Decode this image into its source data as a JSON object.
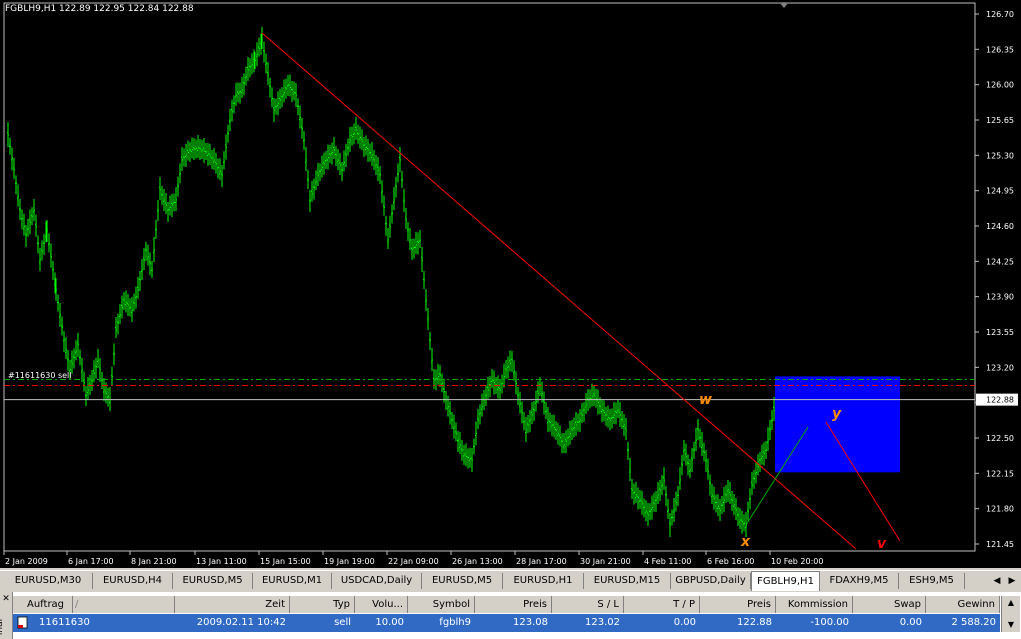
{
  "chart": {
    "symbol_header": "FGBLH9,H1  122.89 122.95 122.84 122.88",
    "current_price": "122.88",
    "order_label": "#11611630 sell",
    "wave_labels": [
      "w",
      "x",
      "y",
      "v"
    ],
    "price_ticks": [
      "126.70",
      "126.35",
      "126.00",
      "125.65",
      "125.30",
      "124.95",
      "124.60",
      "124.25",
      "123.90",
      "123.55",
      "123.20",
      "122.85",
      "122.50",
      "122.15",
      "121.80",
      "121.45"
    ],
    "time_ticks": [
      "2 Jan 2009",
      "6 Jan 17:00",
      "8 Jan 21:00",
      "13 Jan 11:00",
      "15 Jan 15:00",
      "19 Jan 19:00",
      "22 Jan 09:00",
      "26 Jan 13:00",
      "28 Jan 17:00",
      "30 Jan 21:00",
      "4 Feb 11:00",
      "6 Feb 16:00",
      "10 Feb 20:00"
    ],
    "colors": {
      "bars": "#00ff00",
      "trendline": "#ff0000",
      "zone": "#0000ff",
      "wave_orange": "#ff8c00",
      "wave_red": "#ff0000",
      "bid_line": "#c0c0c0"
    }
  },
  "tabs": [
    "EURUSD,M30",
    "EURUSD,H4",
    "EURUSD,M5",
    "EURUSD,M1",
    "USDCAD,Daily",
    "EURUSD,M5",
    "EURUSD,H1",
    "EURUSD,M15",
    "GBPUSD,Daily",
    "FGBLH9,H1",
    "FDAXH9,M5",
    "ESH9,M5"
  ],
  "active_tab": "FGBLH9,H1",
  "terminal": {
    "side_label": "inal",
    "columns": [
      "Auftrag",
      "/",
      "Zeit",
      "Typ",
      "Volu...",
      "Symbol",
      "Preis",
      "S / L",
      "T / P",
      "Preis",
      "Kommission",
      "Swap",
      "Gewinn"
    ],
    "row": {
      "order": "11611630",
      "time": "2009.02.11 10:42",
      "type": "sell",
      "volume": "10.00",
      "symbol": "fgblh9",
      "price": "123.08",
      "sl": "123.02",
      "tp": "0.00",
      "cur_price": "122.88",
      "commission": "-100.00",
      "swap": "0.00",
      "profit": "2 588.20"
    }
  }
}
